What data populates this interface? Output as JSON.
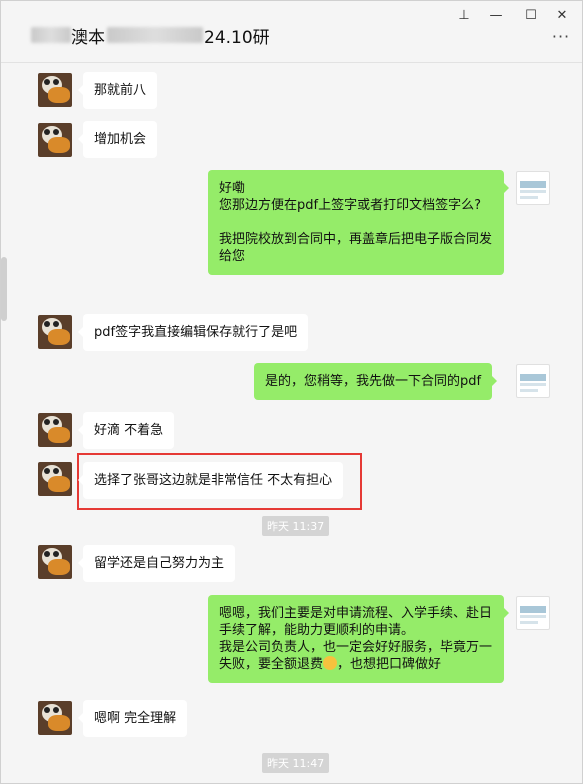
{
  "window": {
    "title_mid": "澳本",
    "title_tail": "24.10研",
    "controls": {
      "pin": "⊥",
      "minimize": "—",
      "maximize": "☐",
      "close": "✕",
      "more": "···"
    }
  },
  "messages": [
    {
      "side": "in",
      "text": "那就前八"
    },
    {
      "side": "in",
      "text": "增加机会"
    },
    {
      "side": "out",
      "text": "好嘞\n您那边方便在pdf上签字或者打印文档签字么?\n\n我把院校放到合同中，再盖章后把电子版合同发给您"
    },
    {
      "side": "in",
      "text": "pdf签字我直接编辑保存就行了是吧"
    },
    {
      "side": "out",
      "text": "是的，您稍等，我先做一下合同的pdf"
    },
    {
      "side": "in",
      "text": "好滴 不着急"
    },
    {
      "side": "in",
      "text": "选择了张哥这边就是非常信任 不太有担心"
    },
    {
      "side": "in",
      "text": "留学还是自己努力为主"
    },
    {
      "side": "out",
      "text_before": "嗯嗯，我们主要是对申请流程、入学手续、赴日手续了解，能助力更顺利的申请。\n我是公司负责人，也一定会好好服务，毕竟万一失败，要全额退费",
      "emoji": "emoji-icon",
      "text_after": "，也想把口碑做好"
    },
    {
      "side": "in",
      "text": "嗯啊 完全理解"
    }
  ],
  "timestamps": [
    "昨天 11:37",
    "昨天 11:47"
  ],
  "colors": {
    "out_bubble": "#95ec69",
    "in_bubble": "#ffffff",
    "highlight": "#e53935",
    "background": "#f5f5f5"
  }
}
